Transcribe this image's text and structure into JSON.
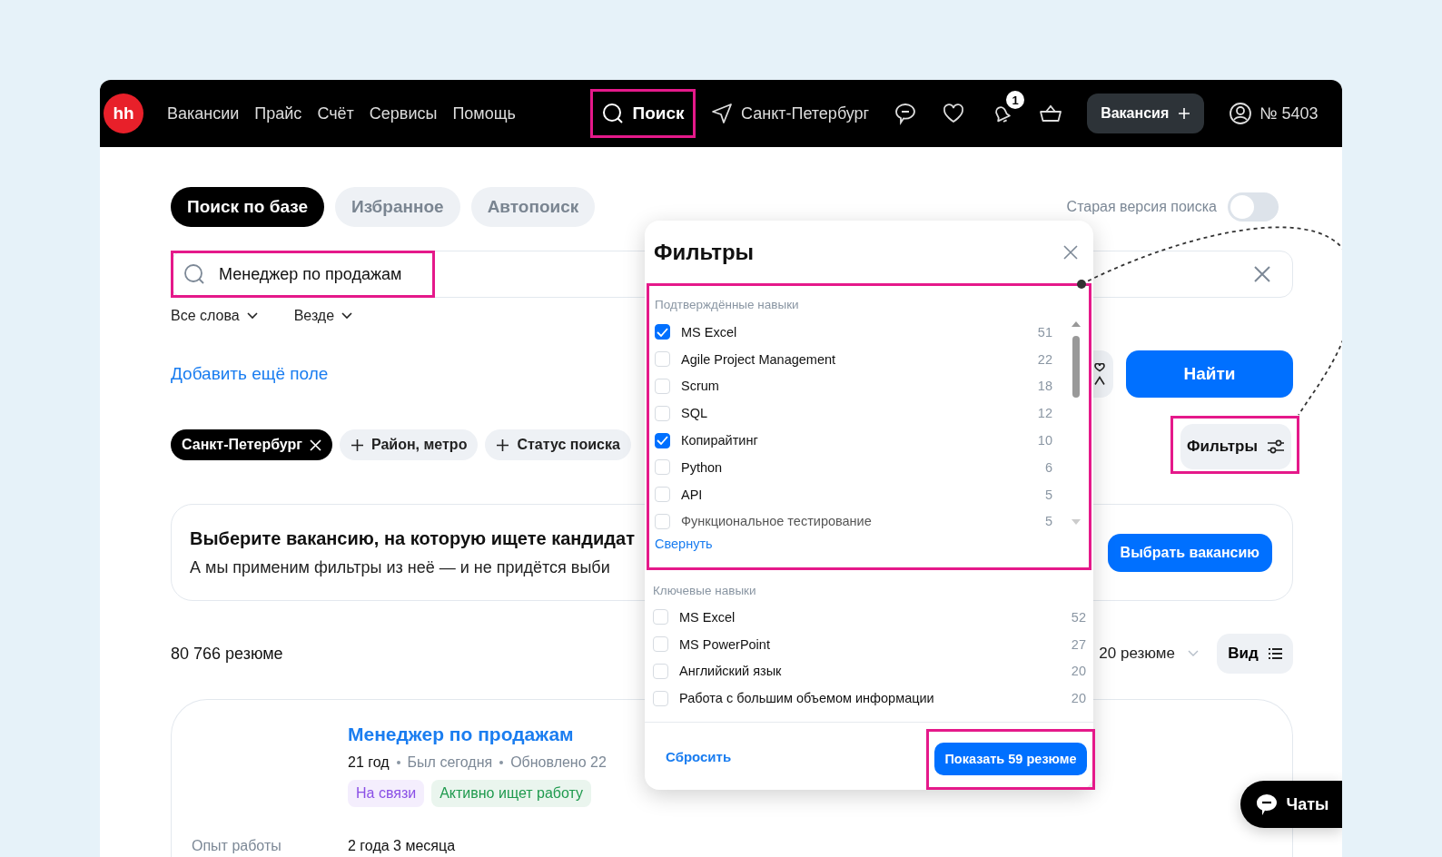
{
  "header": {
    "logo": "hh",
    "nav": [
      "Вакансии",
      "Прайс",
      "Счёт",
      "Сервисы",
      "Помощь"
    ],
    "search_button": "Поиск",
    "location": "Санкт-Петербург",
    "notifications_badge": "1",
    "vacancy_button": "Вакансия",
    "account": "№ 5403"
  },
  "tabs": [
    {
      "label": "Поиск по базе",
      "selected": true
    },
    {
      "label": "Избранное",
      "selected": false
    },
    {
      "label": "Автопоиск",
      "selected": false
    }
  ],
  "old_search_toggle": {
    "label": "Старая версия поиска",
    "on": false
  },
  "search": {
    "value": "Менеджер по продажам"
  },
  "dropdowns": [
    "Все слова",
    "Везде"
  ],
  "add_field_link": "Добавить ещё поле",
  "find_button": "Найти",
  "chips": [
    {
      "label": "Санкт-Петербург",
      "kind": "selected"
    },
    {
      "label": "Район, метро",
      "kind": "add"
    },
    {
      "label": "Статус поиска",
      "kind": "add"
    }
  ],
  "filters_button": "Фильтры",
  "vacancy_prompt": {
    "title": "Выберите вакансию, на которую ищете кандидат",
    "text": "А мы применим фильтры из неё — и не придётся выби",
    "button": "Выбрать вакансию"
  },
  "results": {
    "count": "80 766 резюме",
    "per_page": "20 резюме",
    "view_button": "Вид"
  },
  "resume": {
    "title": "Менеджер по продажам",
    "age": "21 год",
    "meta": [
      "Был сегодня",
      "Обновлено 22"
    ],
    "tags": [
      {
        "label": "На связи",
        "color": "#8a4fe6"
      },
      {
        "label": "Активно ищет работу",
        "color": "#1f9a4e"
      }
    ],
    "experience_label": "Опыт работы",
    "experience": "2 года 3 месяца"
  },
  "filters_panel": {
    "title": "Фильтры",
    "sections": [
      {
        "title": "Подтверждённые навыки",
        "highlighted": true,
        "items": [
          {
            "label": "MS Excel",
            "count": "51",
            "checked": true
          },
          {
            "label": "Agile Project Management",
            "count": "22",
            "checked": false
          },
          {
            "label": "Scrum",
            "count": "18",
            "checked": false
          },
          {
            "label": "SQL",
            "count": "12",
            "checked": false
          },
          {
            "label": "Копирайтинг",
            "count": "10",
            "checked": true
          },
          {
            "label": "Python",
            "count": "6",
            "checked": false
          },
          {
            "label": "API",
            "count": "5",
            "checked": false
          },
          {
            "label": "Функциональное тестирование",
            "count": "5",
            "checked": false
          }
        ],
        "collapse_link": "Свернуть"
      },
      {
        "title": "Ключевые навыки",
        "highlighted": false,
        "items": [
          {
            "label": "MS Excel",
            "count": "52",
            "checked": false
          },
          {
            "label": "MS PowerPoint",
            "count": "27",
            "checked": false
          },
          {
            "label": "Английский язык",
            "count": "20",
            "checked": false
          },
          {
            "label": "Работа с большим объемом информации",
            "count": "20",
            "checked": false
          }
        ]
      }
    ],
    "reset": "Сбросить",
    "apply": "Показать 59 резюме"
  },
  "chat_button": "Чаты"
}
